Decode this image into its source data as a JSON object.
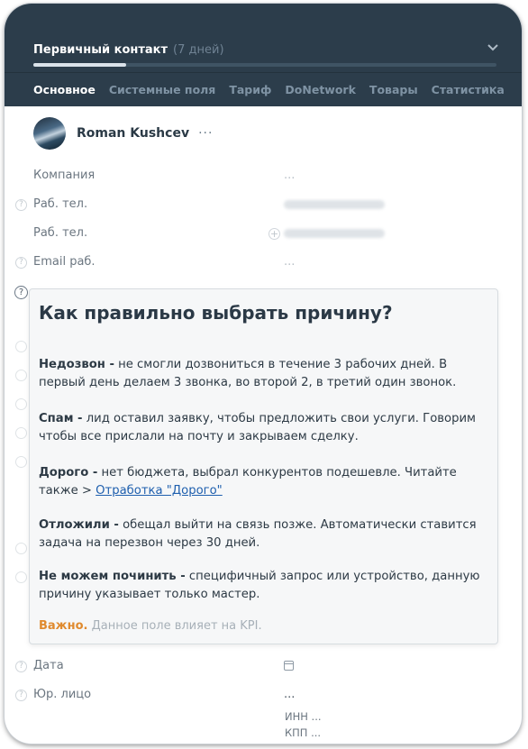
{
  "header": {
    "stage_name": "Первичный контакт",
    "stage_days": "(7 дней)",
    "progress": 0.2,
    "tabs": [
      "Основное",
      "Системные поля",
      "Тариф",
      "DoNetwork",
      "Товары",
      "Статистика"
    ],
    "more": "···"
  },
  "contact": {
    "name": "Roman Kushcev",
    "menu": "···"
  },
  "fields": {
    "company_label": "Компания",
    "company_value": "...",
    "phone1_label": "Раб. тел.",
    "phone2_label": "Раб. тел.",
    "email_label": "Email раб.",
    "email_value": "...",
    "date_label": "Дата",
    "legal_label": "Юр. лицо",
    "legal_value": "...",
    "inn": "ИНН ...",
    "kpp": "КПП ..."
  },
  "tooltip": {
    "title": "Как правильно выбрать причину?",
    "items": [
      {
        "term": "Недозвон -",
        "text": " не смогли дозвониться в течение 3 рабочих дней. В первый день делаем 3 звонка, во второй 2, в третий один звонок."
      },
      {
        "term": "Спам -",
        "text": " лид оставил заявку, чтобы предложить свои услуги. Говорим чтобы все прислали на почту и закрываем сделку."
      },
      {
        "term": "Дорого -",
        "text": " нет бюджета, выбрал конкурентов подешевле. Читайте также > ",
        "link": "Отработка \"Дорого\""
      },
      {
        "term": "Отложили -",
        "text": " обещал выйти на связь позже. Автоматически ставится задача на перезвон через 30 дней."
      },
      {
        "term": "Не можем починить -",
        "text": " специфичный запрос или устройство, данную причину указывает только мастер."
      }
    ],
    "warning_label": "Важно.",
    "warning_text": " Данное поле влияет на KPI."
  },
  "colors": {
    "header_bg": "#2c3d4b",
    "warning": "#e08a2e",
    "link": "#1e5fae"
  }
}
